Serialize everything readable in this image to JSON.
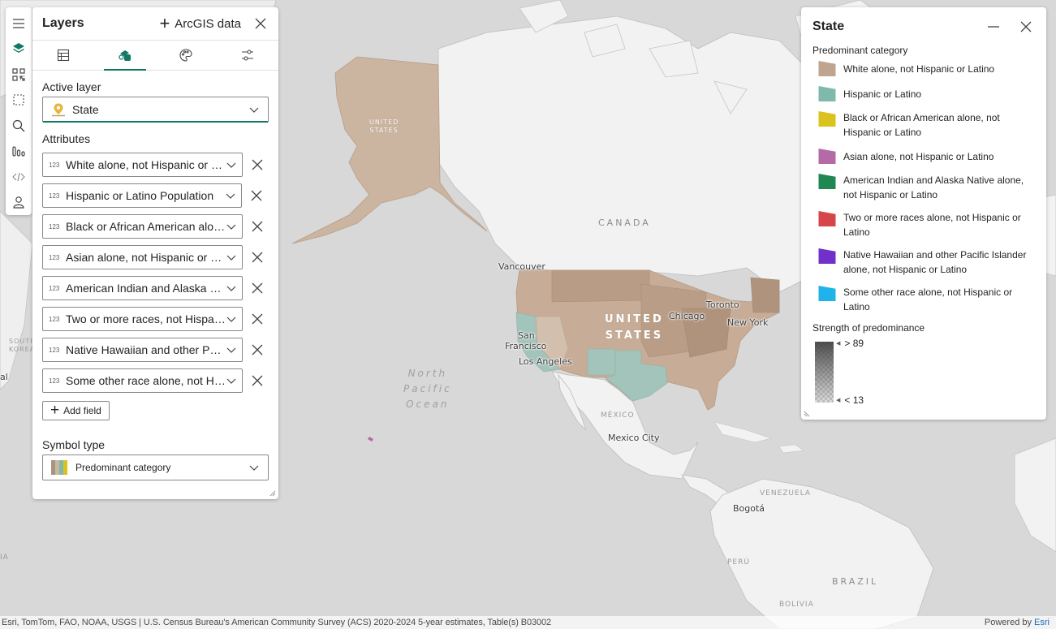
{
  "toolbar": {
    "items": [
      {
        "name": "hamburger-menu-icon"
      },
      {
        "name": "layers-icon",
        "active": true
      },
      {
        "name": "qr-grid-icon"
      },
      {
        "name": "selection-icon"
      },
      {
        "name": "search-icon"
      },
      {
        "name": "analytics-icon"
      },
      {
        "name": "code-icon"
      },
      {
        "name": "user-icon"
      }
    ]
  },
  "layers_panel": {
    "title": "Layers",
    "add_data_label": "ArcGIS data",
    "tabs": [
      {
        "name": "table-icon"
      },
      {
        "name": "symbology-icon",
        "active": true
      },
      {
        "name": "palette-icon"
      },
      {
        "name": "settings-sliders-icon"
      }
    ],
    "active_layer_label": "Active layer",
    "active_layer_value": "State",
    "attributes_label": "Attributes",
    "attributes": [
      {
        "type": "123",
        "label": "White alone, not Hispanic or Latino Population"
      },
      {
        "type": "123",
        "label": "Hispanic or Latino Population"
      },
      {
        "type": "123",
        "label": "Black or African American alone, not Hispanic or Latino Population"
      },
      {
        "type": "123",
        "label": "Asian alone, not Hispanic or Latino Population"
      },
      {
        "type": "123",
        "label": "American Indian and Alaska Native alone, not Hispanic or Latino Population"
      },
      {
        "type": "123",
        "label": "Two or more races, not Hispanic or Latino Population"
      },
      {
        "type": "123",
        "label": "Native Hawaiian and other Pacific Islander alone, not Hispanic or Latino Population"
      },
      {
        "type": "123",
        "label": "Some other race alone, not Hispanic or Latino Population"
      }
    ],
    "add_field_label": "Add field",
    "symbol_type_label": "Symbol type",
    "symbol_type_value": "Predominant category"
  },
  "legend": {
    "title": "State",
    "subtitle": "Predominant category",
    "items": [
      {
        "label": "White alone, not Hispanic or Latino",
        "color": "#bfa58f"
      },
      {
        "label": "Hispanic or Latino",
        "color": "#7fb9ac"
      },
      {
        "label": "Black or African American alone, not Hispanic or Latino",
        "color": "#dcc21e"
      },
      {
        "label": "Asian alone, not Hispanic or Latino",
        "color": "#b56aa6"
      },
      {
        "label": "American Indian and Alaska Native alone, not Hispanic or Latino",
        "color": "#218752"
      },
      {
        "label": "Two or more races alone, not Hispanic or Latino",
        "color": "#d6454a"
      },
      {
        "label": "Native Hawaiian and other Pacific Islander alone, not Hispanic or Latino",
        "color": "#7030c9"
      },
      {
        "label": "Some other race alone, not Hispanic or Latino",
        "color": "#1fb3ea"
      }
    ],
    "strength_title": "Strength of predominance",
    "strength_high": "> 89",
    "strength_low": "< 13"
  },
  "map": {
    "labels": {
      "canada": "CANADA",
      "united_states_line1": "UNITED",
      "united_states_line2": "STATES",
      "alaska_line1": "UNITED",
      "alaska_line2": "STATES",
      "mexico": "MÉXICO",
      "venezuela": "VENEZUELA",
      "peru": "PERÚ",
      "brazil": "BRAZIL",
      "bolivia": "BOLIVIA",
      "south_korea_line1": "SOUTH",
      "south_korea_line2": "KOREA",
      "asia_edge": "al",
      "africa_edge": "IA",
      "ocean_line1": "North",
      "ocean_line2": "Pacific",
      "ocean_line3": "Ocean"
    },
    "cities": {
      "vancouver": "Vancouver",
      "san_francisco_line1": "San",
      "san_francisco_line2": "Francisco",
      "los_angeles": "Los Angeles",
      "chicago": "Chicago",
      "toronto": "Toronto",
      "new_york": "New York",
      "mexico_city": "Mexico City",
      "bogota": "Bogotá"
    }
  },
  "attribution": {
    "text": "Esri, TomTom, FAO, NOAA, USGS | U.S. Census Bureau's American Community Survey (ACS) 2020-2024 5-year estimates, Table(s) B03002",
    "powered_by": "Powered by",
    "brand": "Esri"
  }
}
